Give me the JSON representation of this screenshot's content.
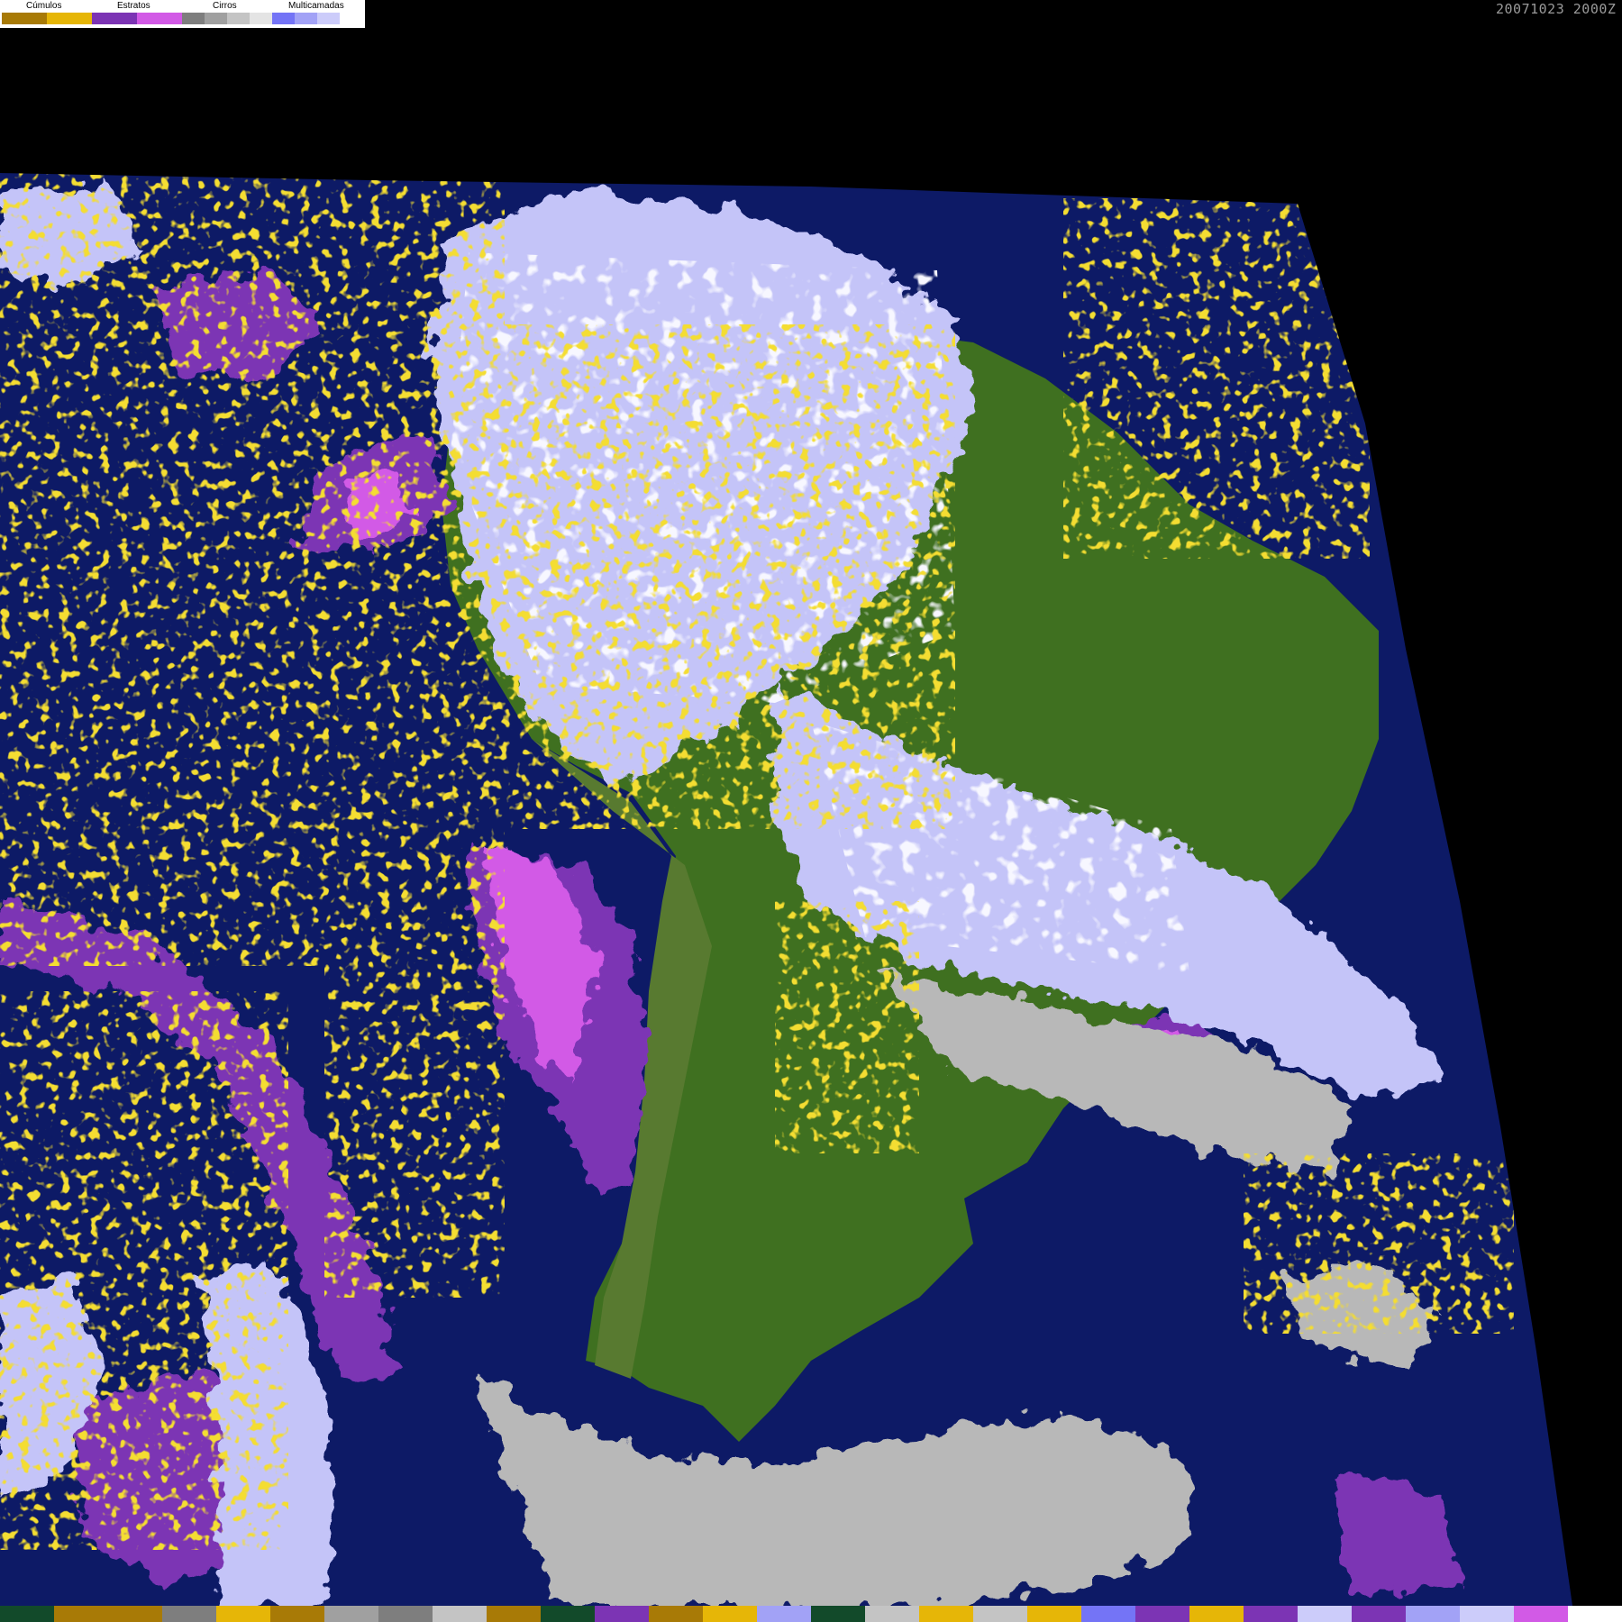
{
  "legend": {
    "groups": [
      {
        "label": "Cúmulos",
        "colors": [
          "#a87a06",
          "#e6b607"
        ]
      },
      {
        "label": "Estratos",
        "colors": [
          "#7c34b4",
          "#d25ae6"
        ]
      },
      {
        "label": "Cirros",
        "colors": [
          "#7e7e7e",
          "#a0a0a0",
          "#c4c4c4",
          "#e4e4e4"
        ]
      },
      {
        "label": "Multicamadas",
        "colors": [
          "#7474f6",
          "#a2a2f6",
          "#ccccfa"
        ]
      }
    ]
  },
  "timestamp": "20071023 2000Z",
  "colors": {
    "background": "#000000",
    "ocean": "#0d1a66",
    "land": "#3f7020",
    "andes": "#587a30",
    "cumulus_low": "#a87a06",
    "cumulus_high": "#e6b607",
    "stratus_dark": "#7c34b4",
    "stratus_light": "#d25ae6",
    "cirrus": "#b8b8b8",
    "multilayer": "#c4c4f8",
    "multilayer_bright": "#e8e8fc"
  },
  "bottom_bar_colors": [
    "#124a2a",
    "#a87a06",
    "#a87a06",
    "#7e7e7e",
    "#e6b607",
    "#a87a06",
    "#a0a0a0",
    "#7e7e7e",
    "#c4c4c4",
    "#a87a06",
    "#124a2a",
    "#7c34b4",
    "#a87a06",
    "#e6b607",
    "#a2a2f6",
    "#124a2a",
    "#c4c4c4",
    "#e6b607",
    "#c4c4c4",
    "#e6b607",
    "#7474f6",
    "#7c34b4",
    "#e6b607",
    "#7c34b4",
    "#ccccfa",
    "#7c34b4",
    "#a2a2f6",
    "#ccccfa",
    "#d25ae6",
    "#ffffff"
  ]
}
